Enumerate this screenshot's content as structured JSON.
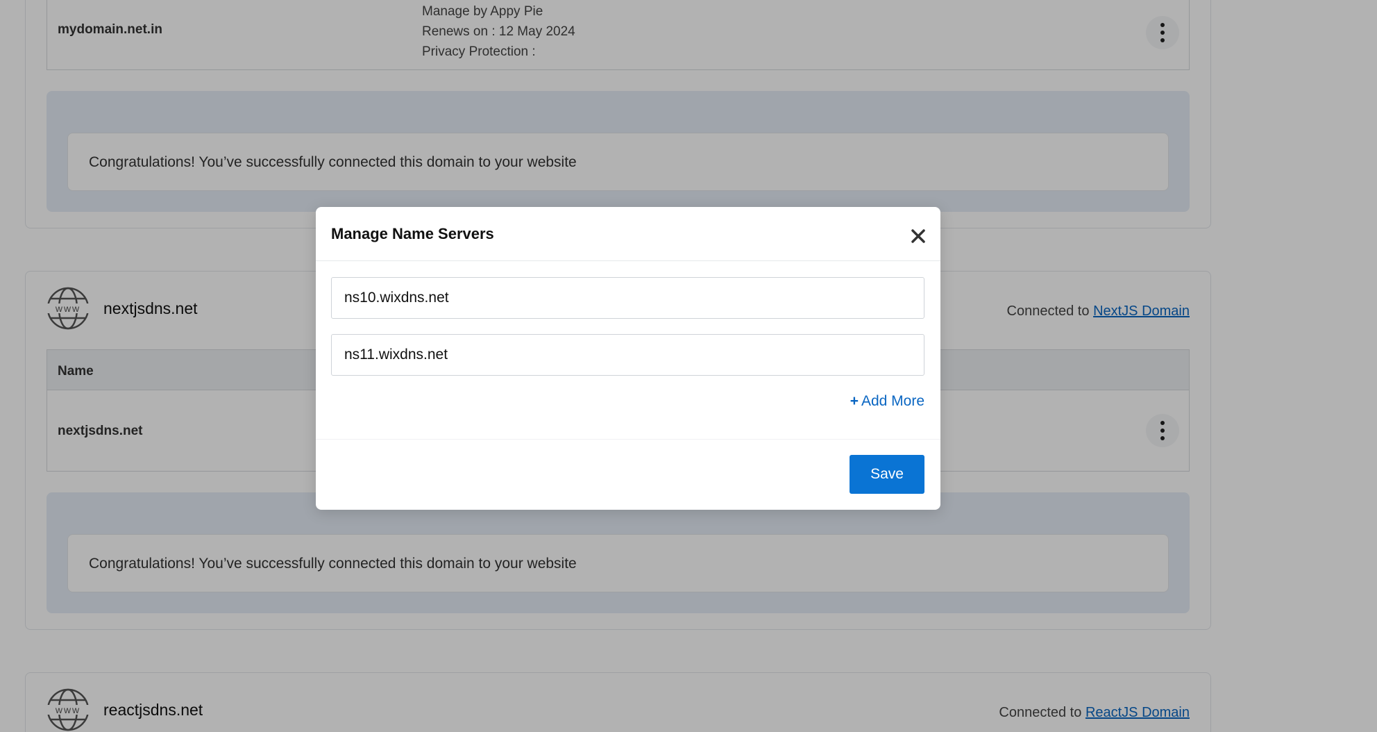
{
  "colors": {
    "accent": "#0a74d4",
    "link": "#0a66c2",
    "overlay": "rgba(0,0,0,0.30)",
    "notice_bg": "#e5edf7"
  },
  "cards": [
    {
      "table": {
        "row": {
          "name": "mydomain.net.in",
          "info": [
            "Manage by Appy Pie",
            "Renews on : 12 May 2024",
            "Privacy Protection :"
          ]
        }
      },
      "notice": "Congratulations! You’ve successfully connected this domain to your website"
    },
    {
      "domain": "nextjsdns.net",
      "connected_prefix": "Connected to",
      "connected_link": "NextJS Domain",
      "table": {
        "header_name": "Name",
        "row": {
          "name": "nextjsdns.net"
        }
      },
      "notice": "Congratulations! You’ve successfully connected this domain to your website"
    },
    {
      "domain": "reactjsdns.net",
      "connected_prefix": "Connected to",
      "connected_link": "ReactJS Domain"
    }
  ],
  "icons": {
    "globe": "www-globe-icon",
    "kebab": "more-vertical-icon",
    "close": "close-icon",
    "plus": "plus-icon"
  },
  "modal": {
    "title": "Manage Name Servers",
    "name_servers": [
      "ns10.wixdns.net",
      "ns11.wixdns.net"
    ],
    "add_more_label": "Add More",
    "add_more_prefix": "+",
    "save_label": "Save"
  }
}
